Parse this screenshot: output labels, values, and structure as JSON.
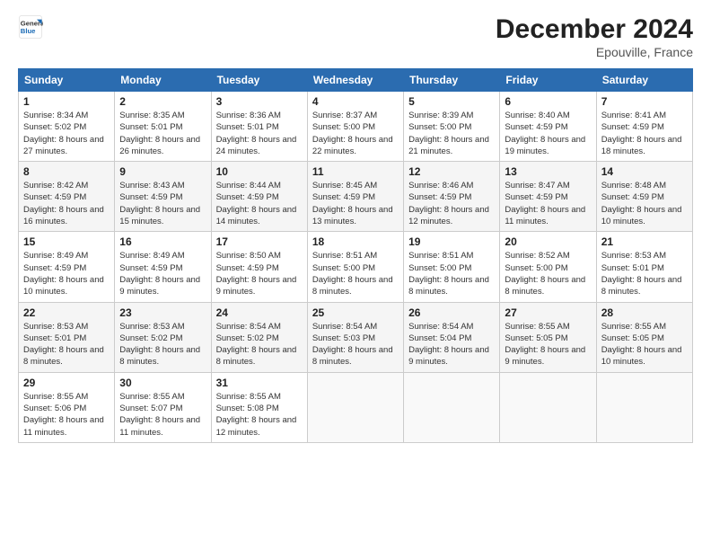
{
  "logo": {
    "line1": "General",
    "line2": "Blue"
  },
  "header": {
    "month": "December 2024",
    "location": "Epouville, France"
  },
  "weekdays": [
    "Sunday",
    "Monday",
    "Tuesday",
    "Wednesday",
    "Thursday",
    "Friday",
    "Saturday"
  ],
  "weeks": [
    [
      {
        "day": "1",
        "rise": "Sunrise: 8:34 AM",
        "set": "Sunset: 5:02 PM",
        "daylight": "Daylight: 8 hours and 27 minutes."
      },
      {
        "day": "2",
        "rise": "Sunrise: 8:35 AM",
        "set": "Sunset: 5:01 PM",
        "daylight": "Daylight: 8 hours and 26 minutes."
      },
      {
        "day": "3",
        "rise": "Sunrise: 8:36 AM",
        "set": "Sunset: 5:01 PM",
        "daylight": "Daylight: 8 hours and 24 minutes."
      },
      {
        "day": "4",
        "rise": "Sunrise: 8:37 AM",
        "set": "Sunset: 5:00 PM",
        "daylight": "Daylight: 8 hours and 22 minutes."
      },
      {
        "day": "5",
        "rise": "Sunrise: 8:39 AM",
        "set": "Sunset: 5:00 PM",
        "daylight": "Daylight: 8 hours and 21 minutes."
      },
      {
        "day": "6",
        "rise": "Sunrise: 8:40 AM",
        "set": "Sunset: 4:59 PM",
        "daylight": "Daylight: 8 hours and 19 minutes."
      },
      {
        "day": "7",
        "rise": "Sunrise: 8:41 AM",
        "set": "Sunset: 4:59 PM",
        "daylight": "Daylight: 8 hours and 18 minutes."
      }
    ],
    [
      {
        "day": "8",
        "rise": "Sunrise: 8:42 AM",
        "set": "Sunset: 4:59 PM",
        "daylight": "Daylight: 8 hours and 16 minutes."
      },
      {
        "day": "9",
        "rise": "Sunrise: 8:43 AM",
        "set": "Sunset: 4:59 PM",
        "daylight": "Daylight: 8 hours and 15 minutes."
      },
      {
        "day": "10",
        "rise": "Sunrise: 8:44 AM",
        "set": "Sunset: 4:59 PM",
        "daylight": "Daylight: 8 hours and 14 minutes."
      },
      {
        "day": "11",
        "rise": "Sunrise: 8:45 AM",
        "set": "Sunset: 4:59 PM",
        "daylight": "Daylight: 8 hours and 13 minutes."
      },
      {
        "day": "12",
        "rise": "Sunrise: 8:46 AM",
        "set": "Sunset: 4:59 PM",
        "daylight": "Daylight: 8 hours and 12 minutes."
      },
      {
        "day": "13",
        "rise": "Sunrise: 8:47 AM",
        "set": "Sunset: 4:59 PM",
        "daylight": "Daylight: 8 hours and 11 minutes."
      },
      {
        "day": "14",
        "rise": "Sunrise: 8:48 AM",
        "set": "Sunset: 4:59 PM",
        "daylight": "Daylight: 8 hours and 10 minutes."
      }
    ],
    [
      {
        "day": "15",
        "rise": "Sunrise: 8:49 AM",
        "set": "Sunset: 4:59 PM",
        "daylight": "Daylight: 8 hours and 10 minutes."
      },
      {
        "day": "16",
        "rise": "Sunrise: 8:49 AM",
        "set": "Sunset: 4:59 PM",
        "daylight": "Daylight: 8 hours and 9 minutes."
      },
      {
        "day": "17",
        "rise": "Sunrise: 8:50 AM",
        "set": "Sunset: 4:59 PM",
        "daylight": "Daylight: 8 hours and 9 minutes."
      },
      {
        "day": "18",
        "rise": "Sunrise: 8:51 AM",
        "set": "Sunset: 5:00 PM",
        "daylight": "Daylight: 8 hours and 8 minutes."
      },
      {
        "day": "19",
        "rise": "Sunrise: 8:51 AM",
        "set": "Sunset: 5:00 PM",
        "daylight": "Daylight: 8 hours and 8 minutes."
      },
      {
        "day": "20",
        "rise": "Sunrise: 8:52 AM",
        "set": "Sunset: 5:00 PM",
        "daylight": "Daylight: 8 hours and 8 minutes."
      },
      {
        "day": "21",
        "rise": "Sunrise: 8:53 AM",
        "set": "Sunset: 5:01 PM",
        "daylight": "Daylight: 8 hours and 8 minutes."
      }
    ],
    [
      {
        "day": "22",
        "rise": "Sunrise: 8:53 AM",
        "set": "Sunset: 5:01 PM",
        "daylight": "Daylight: 8 hours and 8 minutes."
      },
      {
        "day": "23",
        "rise": "Sunrise: 8:53 AM",
        "set": "Sunset: 5:02 PM",
        "daylight": "Daylight: 8 hours and 8 minutes."
      },
      {
        "day": "24",
        "rise": "Sunrise: 8:54 AM",
        "set": "Sunset: 5:02 PM",
        "daylight": "Daylight: 8 hours and 8 minutes."
      },
      {
        "day": "25",
        "rise": "Sunrise: 8:54 AM",
        "set": "Sunset: 5:03 PM",
        "daylight": "Daylight: 8 hours and 8 minutes."
      },
      {
        "day": "26",
        "rise": "Sunrise: 8:54 AM",
        "set": "Sunset: 5:04 PM",
        "daylight": "Daylight: 8 hours and 9 minutes."
      },
      {
        "day": "27",
        "rise": "Sunrise: 8:55 AM",
        "set": "Sunset: 5:05 PM",
        "daylight": "Daylight: 8 hours and 9 minutes."
      },
      {
        "day": "28",
        "rise": "Sunrise: 8:55 AM",
        "set": "Sunset: 5:05 PM",
        "daylight": "Daylight: 8 hours and 10 minutes."
      }
    ],
    [
      {
        "day": "29",
        "rise": "Sunrise: 8:55 AM",
        "set": "Sunset: 5:06 PM",
        "daylight": "Daylight: 8 hours and 11 minutes."
      },
      {
        "day": "30",
        "rise": "Sunrise: 8:55 AM",
        "set": "Sunset: 5:07 PM",
        "daylight": "Daylight: 8 hours and 11 minutes."
      },
      {
        "day": "31",
        "rise": "Sunrise: 8:55 AM",
        "set": "Sunset: 5:08 PM",
        "daylight": "Daylight: 8 hours and 12 minutes."
      },
      null,
      null,
      null,
      null
    ]
  ]
}
